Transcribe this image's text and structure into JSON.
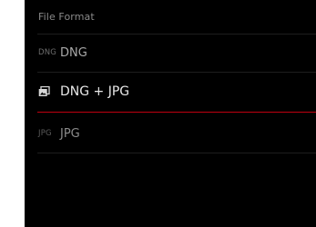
{
  "menu": {
    "title": "File Format",
    "options": [
      {
        "icon_text": "DNG",
        "label": "DNG",
        "state": "normal"
      },
      {
        "icon": "dng-jpg-stack-icon",
        "label": "DNG + JPG",
        "state": "selected"
      },
      {
        "icon_text": "JPG",
        "label": "JPG",
        "state": "dim"
      }
    ]
  },
  "colors": {
    "background": "#000000",
    "selection_underline": "#c00010",
    "text_selected": "#e8e8e8",
    "text_normal": "#a9a9a9"
  }
}
